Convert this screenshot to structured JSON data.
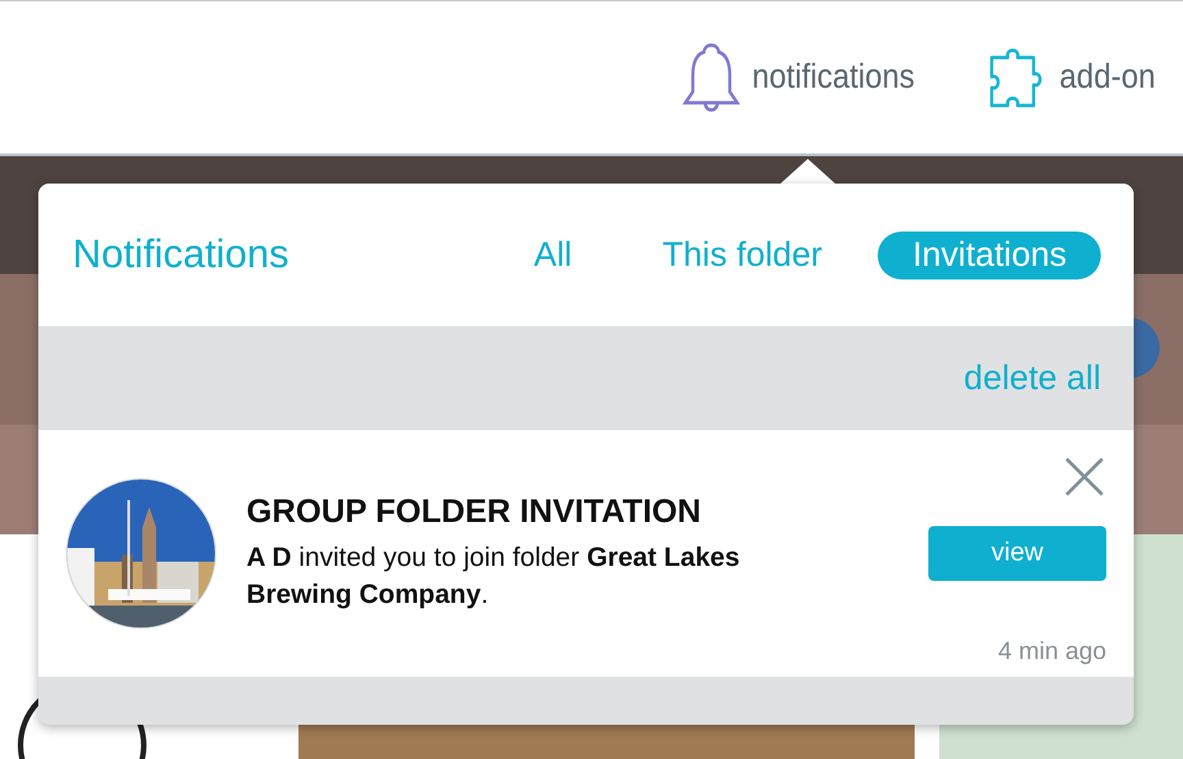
{
  "top_bar": {
    "items": [
      {
        "kind": "bell",
        "label": "notifications"
      },
      {
        "kind": "puzzle",
        "label": "add-on"
      }
    ]
  },
  "popover": {
    "title": "Notifications",
    "tabs": [
      {
        "label": "All",
        "selected": false
      },
      {
        "label": "This folder",
        "selected": false
      },
      {
        "label": "Invitations",
        "selected": true
      }
    ],
    "delete_all": "delete all",
    "notifications": [
      {
        "title": "GROUP FOLDER INVITATION",
        "message": "**A D** invited you to join folder **Great Lakes Brewing Company**.",
        "action": "view",
        "time": "4 min ago"
      }
    ]
  }
}
